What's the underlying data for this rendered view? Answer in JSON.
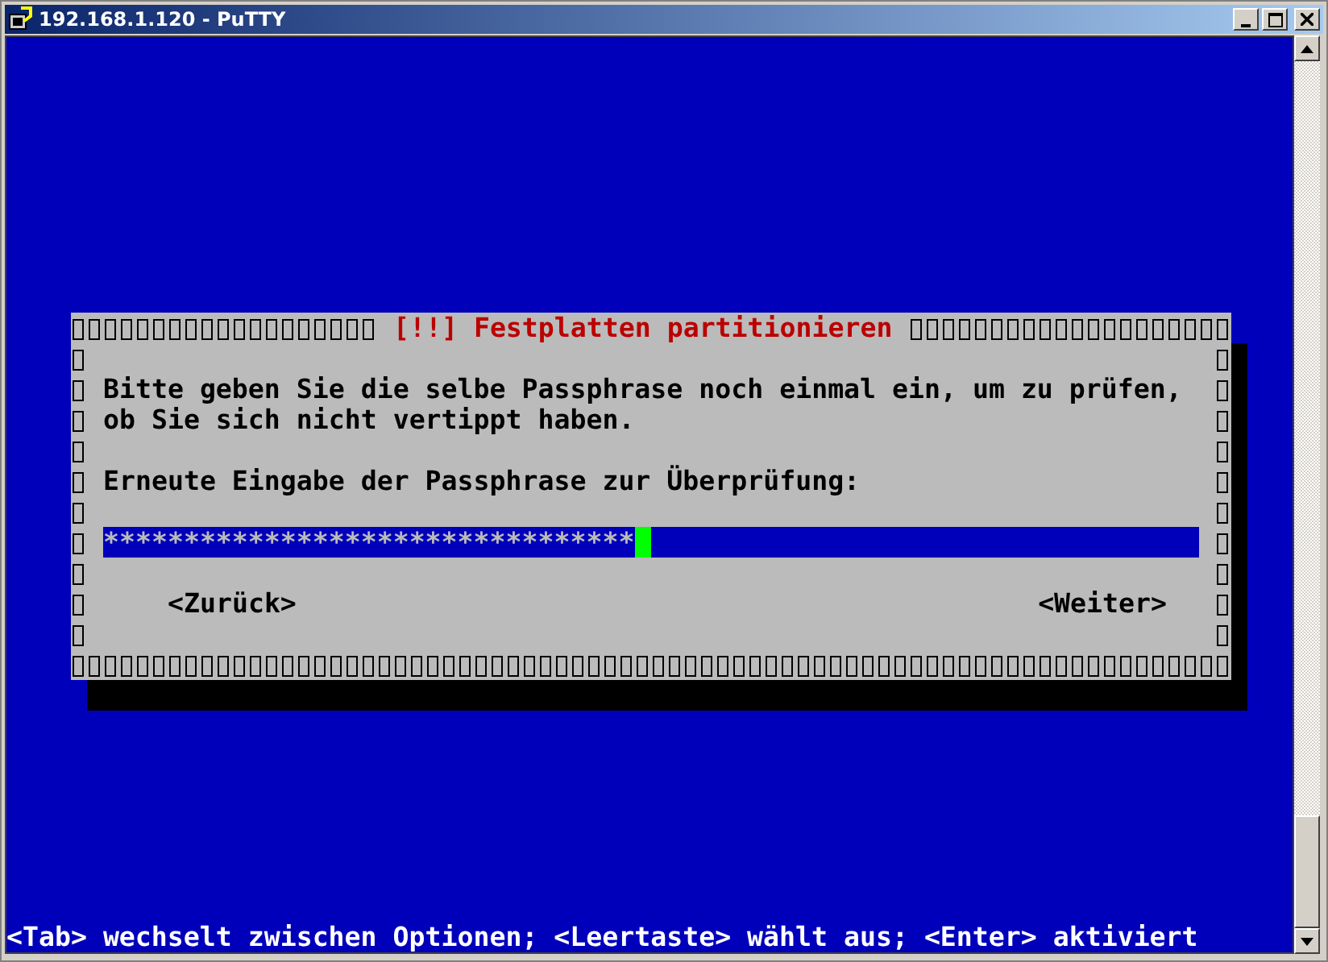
{
  "window": {
    "title": "192.168.1.120 - PuTTY"
  },
  "dialog": {
    "title": "[!!] Festplatten partitionieren",
    "message": [
      "Bitte geben Sie die selbe Passphrase noch einmal ein, um zu prüfen,",
      "ob Sie sich nicht vertippt haben."
    ],
    "field_label": "Erneute Eingabe der Passphrase zur Überprüfung:",
    "field": {
      "value": "*********************************"
    },
    "buttons": [
      "<Zurück>",
      "<Weiter>"
    ]
  },
  "status_line": "<Tab> wechselt zwischen Optionen; <Leertaste> wählt aus; <Enter> aktiviert"
}
